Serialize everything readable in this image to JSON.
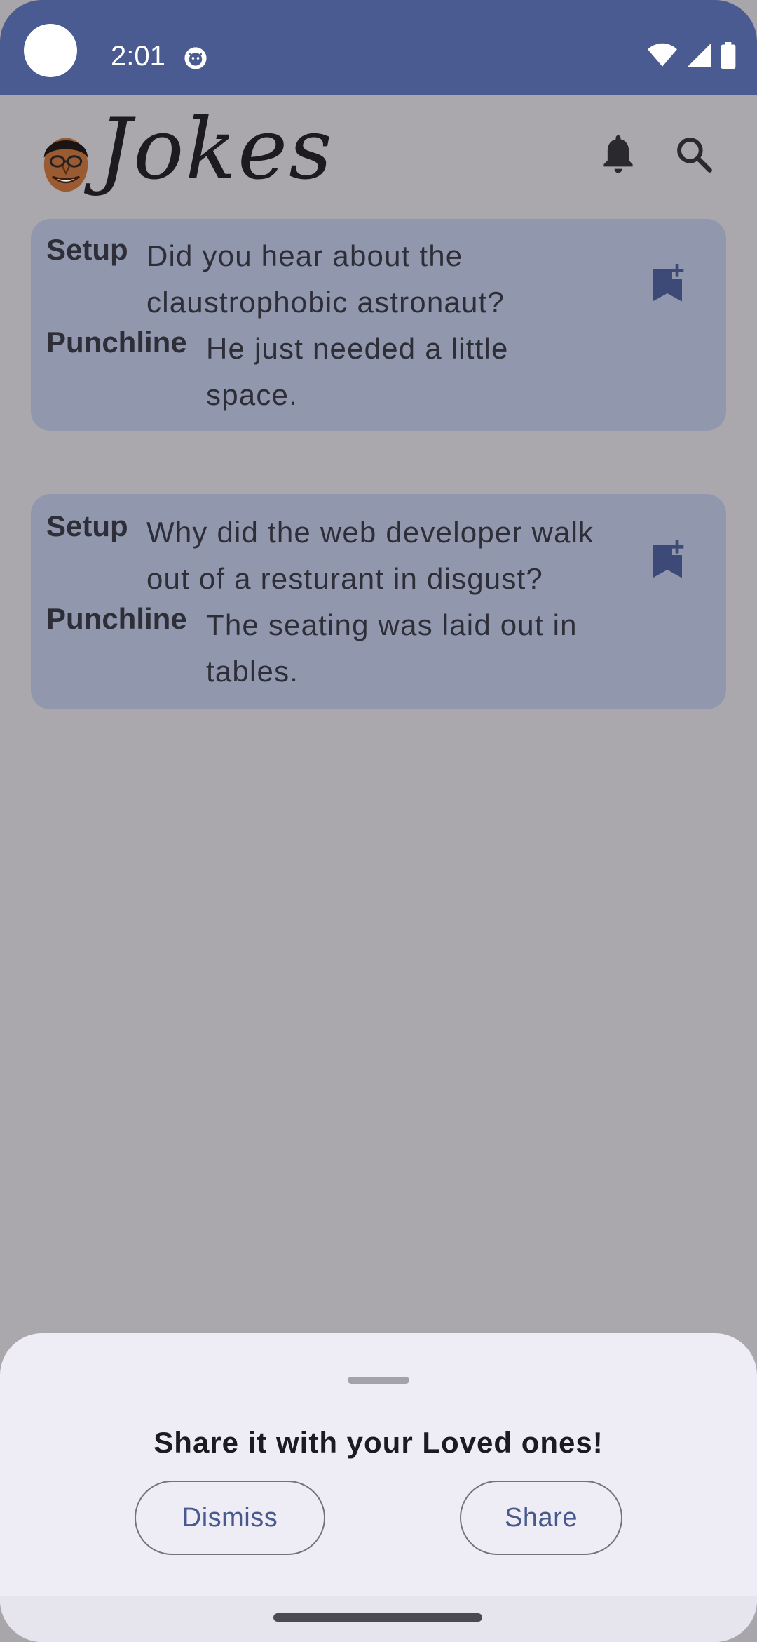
{
  "status_bar": {
    "time": "2:01",
    "icons": [
      "camera-cutout",
      "app-notification-icon",
      "wifi-icon",
      "signal-icon",
      "battery-icon"
    ]
  },
  "app_bar": {
    "title": "Jokes",
    "actions": [
      "bell-icon",
      "search-icon"
    ]
  },
  "jokes": [
    {
      "setup_label": "Setup",
      "setup": "Did you hear about the claustrophobic astronaut?",
      "punchline_label": "Punchline",
      "punchline": "He just needed a little space."
    },
    {
      "setup_label": "Setup",
      "setup": "Why did the web developer walk out of a resturant in disgust?",
      "punchline_label": "Punchline",
      "punchline": "The seating was laid out in tables."
    }
  ],
  "bottom_sheet": {
    "title": "Share it with your Loved ones!",
    "dismiss_label": "Dismiss",
    "share_label": "Share"
  },
  "colors": {
    "primary": "#4a5b92",
    "card": "#9197ad",
    "scrim": "#aaa8ad",
    "sheet": "#eeedf6",
    "button_text": "#47598f"
  }
}
